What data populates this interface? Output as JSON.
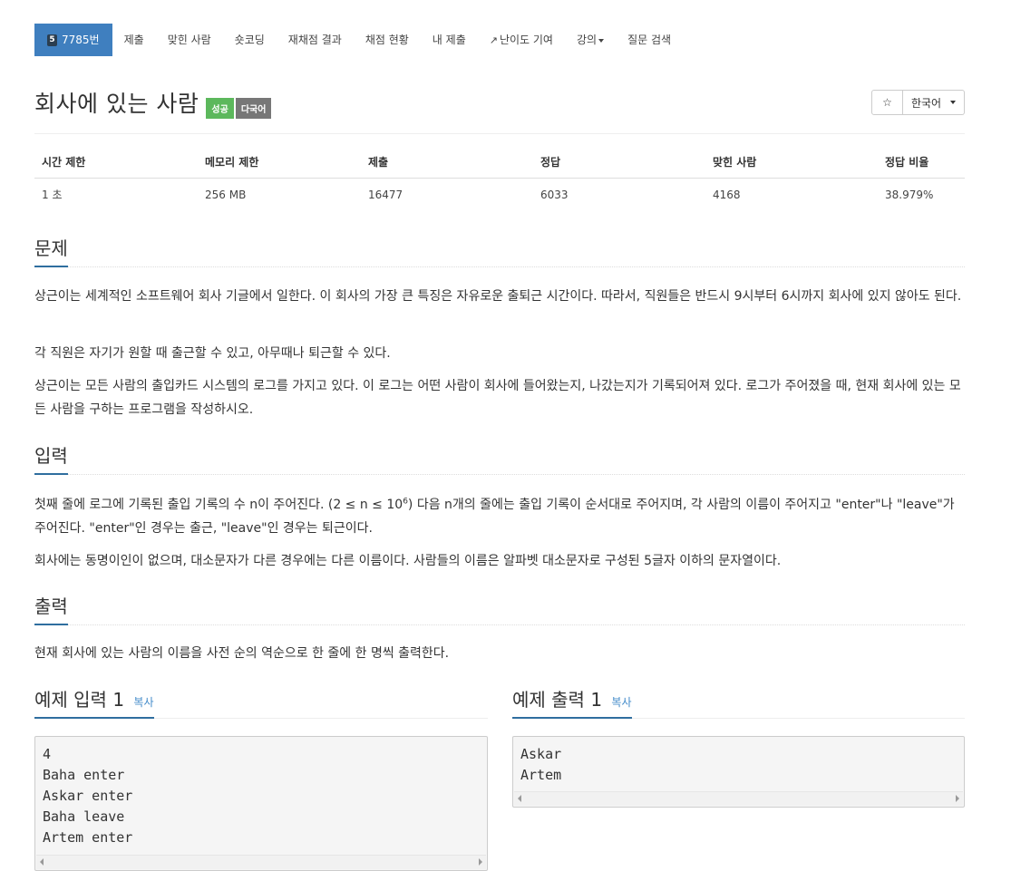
{
  "nav": {
    "problem_number": "7785번",
    "tier_badge": "5",
    "items": [
      "제출",
      "맞힌 사람",
      "숏코딩",
      "재채점 결과",
      "채점 현황",
      "내 제출",
      "난이도 기여",
      "강의",
      "질문 검색"
    ]
  },
  "title": {
    "text": "회사에 있는 사람",
    "label_success": "성공",
    "label_multilang": "다국어"
  },
  "toolbar": {
    "star": "☆",
    "language": "한국어"
  },
  "stats": {
    "headers": [
      "시간 제한",
      "메모리 제한",
      "제출",
      "정답",
      "맞힌 사람",
      "정답 비율"
    ],
    "values": [
      "1 초",
      "256 MB",
      "16477",
      "6033",
      "4168",
      "38.979%"
    ]
  },
  "problem": {
    "heading": "문제",
    "p1": "상근이는 세계적인 소프트웨어 회사 기글에서 일한다. 이 회사의 가장 큰 특징은 자유로운 출퇴근 시간이다. 따라서, 직원들은 반드시 9시부터 6시까지 회사에 있지 않아도 된다.",
    "p2": "각 직원은 자기가 원할 때 출근할 수 있고, 아무때나 퇴근할 수 있다.",
    "p3": "상근이는 모든 사람의 출입카드 시스템의 로그를 가지고 있다. 이 로그는 어떤 사람이 회사에 들어왔는지, 나갔는지가 기록되어져 있다. 로그가 주어졌을 때, 현재 회사에 있는 모든 사람을 구하는 프로그램을 작성하시오."
  },
  "input": {
    "heading": "입력",
    "p1_a": "첫째 줄에 로그에 기록된 출입 기록의 수 n이 주어진다. (2 ≤ n ≤ 10",
    "p1_sup": "6",
    "p1_b": ") 다음 n개의 줄에는 출입 기록이 순서대로 주어지며, 각 사람의 이름이 주어지고 \"enter\"나 \"leave\"가 주어진다. \"enter\"인 경우는 출근, \"leave\"인 경우는 퇴근이다.",
    "p2": "회사에는 동명이인이 없으며, 대소문자가 다른 경우에는 다른 이름이다. 사람들의 이름은 알파벳 대소문자로 구성된 5글자 이하의 문자열이다."
  },
  "output": {
    "heading": "출력",
    "p1": "현재 회사에 있는 사람의 이름을 사전 순의 역순으로 한 줄에 한 명씩 출력한다."
  },
  "sample_input": {
    "heading": "예제 입력 1",
    "copy": "복사",
    "content": "4\nBaha enter\nAskar enter\nBaha leave\nArtem enter"
  },
  "sample_output": {
    "heading": "예제 출력 1",
    "copy": "복사",
    "content": "Askar\nArtem"
  }
}
